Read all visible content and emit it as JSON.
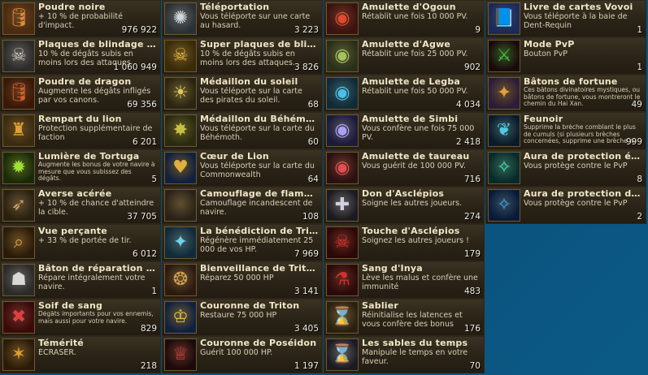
{
  "items": [
    {
      "name": "Poudre noire",
      "desc": "+ 10 % de probabilité d'impact.",
      "count": "976 922",
      "icon": "barrel-icon",
      "glyph": "🛢",
      "bg": "#4a2a10",
      "fg": "#e08a3a"
    },
    {
      "name": "Téléportation",
      "desc": "Vous téléporte sur une carte au hasard.",
      "count": "3 223",
      "icon": "compass-icon",
      "glyph": "✺",
      "bg": "#2a3036",
      "fg": "#cfd8e0"
    },
    {
      "name": "Amulette d'Ogoun",
      "desc": "Rétablit une fois 10 000 PV.",
      "count": "9",
      "icon": "red-amulet-icon",
      "glyph": "◉",
      "bg": "#3a1210",
      "fg": "#e04a30"
    },
    {
      "name": "Livre de cartes Vovoi",
      "desc": "Vous téléporte à la baie de Dent-Requin",
      "count": "1",
      "icon": "book-icon",
      "glyph": "📘",
      "bg": "#1c2a5a",
      "fg": "#5a7ad8"
    },
    {
      "name": "Plaques de blindage d'...",
      "desc": "10 % de dégâts subis en moins lors des attaques.",
      "count": "1 060 949",
      "icon": "skull-shield-icon",
      "glyph": "☠",
      "bg": "#2a2a2a",
      "fg": "#c8c8c8"
    },
    {
      "name": "Super plaques de blind...",
      "desc": "10 % de dégâts subis en moins lors des attaques.",
      "count": "3 826",
      "icon": "gold-skull-shield-icon",
      "glyph": "☠",
      "bg": "#3a2a08",
      "fg": "#e8b840"
    },
    {
      "name": "Amulette d'Agwe",
      "desc": "Rétablit une fois 25 000 PV.",
      "count": "902",
      "icon": "green-amulet-icon",
      "glyph": "◉",
      "bg": "#2a3018",
      "fg": "#a8c060"
    },
    {
      "name": "Mode PvP",
      "desc": "Bouton PvP",
      "count": "1",
      "icon": "crossed-swords-icon",
      "glyph": "⚔",
      "bg": "#1a0a0a",
      "fg": "#40c040"
    },
    {
      "name": "Poudre de dragon",
      "desc": "Augmente les dégâts infligés par vos canons.",
      "count": "69 356",
      "icon": "dragon-barrel-icon",
      "glyph": "🛢",
      "bg": "#3a1808",
      "fg": "#d0602a"
    },
    {
      "name": "Médaillon du soleil",
      "desc": "Vous téléporte sur la carte des pirates du soleil.",
      "count": "68",
      "icon": "sun-medallion-icon",
      "glyph": "☀",
      "bg": "#2a2410",
      "fg": "#e0c860"
    },
    {
      "name": "Amulette de Legba",
      "desc": "Rétablit une fois 50 000 PV.",
      "count": "4 034",
      "icon": "blue-amulet-icon",
      "glyph": "◉",
      "bg": "#102a3a",
      "fg": "#4ac0e8"
    },
    {
      "name": "Bâtons de fortune",
      "desc": "Ces bâtons divinatoires mystiques, ou bâtons de fortune, vous montreront le chemin du Hai Xan.",
      "count": "49",
      "icon": "fortune-sticks-icon",
      "glyph": "✦",
      "bg": "#2a1c3a",
      "fg": "#e0a040",
      "small": true
    },
    {
      "name": "Rempart du lion",
      "desc": "Protection supplémentaire de faction",
      "count": "6 201",
      "icon": "lion-rampart-icon",
      "glyph": "♜",
      "bg": "#3a2a10",
      "fg": "#e0a030"
    },
    {
      "name": "Médaillon du Béhémoth",
      "desc": "Vous téléporte sur la carte du Béhémoth.",
      "count": "60",
      "icon": "behemoth-medallion-icon",
      "glyph": "✸",
      "bg": "#2a2a10",
      "fg": "#c8c040"
    },
    {
      "name": "Amulette de Simbi",
      "desc": "Vous confère une fois 75 000 PV.",
      "count": "2 418",
      "icon": "violet-amulet-icon",
      "glyph": "◉",
      "bg": "#1a1a3a",
      "fg": "#a8a0f0"
    },
    {
      "name": "Feunoir",
      "desc": "Supprime la brèche comblant le plus de cumuls (si plusieurs brèches concernées, supprime une brèche au",
      "count": "999",
      "icon": "black-flame-icon",
      "glyph": "❦",
      "bg": "#0a1a2a",
      "fg": "#50c8e8",
      "small": true
    },
    {
      "name": "Lumière de Tortuga",
      "desc": "Augmente les bonus de votre navire à mesure que vous subissez des dégâts.",
      "count": "5",
      "icon": "green-lantern-icon",
      "glyph": "✹",
      "bg": "#1a2a08",
      "fg": "#a0e030",
      "small": true
    },
    {
      "name": "Cœur de Lion",
      "desc": "Vous téléporte sur la carte du Commonwealth",
      "count": "64",
      "icon": "lion-heart-icon",
      "glyph": "♥",
      "bg": "#102040",
      "fg": "#e0b040"
    },
    {
      "name": "Amulette de taureau",
      "desc": "Vous guérit de 100 000 PV.",
      "count": "716",
      "icon": "bull-amulet-icon",
      "glyph": "◉",
      "bg": "#2a1010",
      "fg": "#e05050"
    },
    {
      "name": "Aura de protection éph...",
      "desc": "Vous protège contre le PvP",
      "count": "8",
      "icon": "teal-aura-icon",
      "glyph": "✧",
      "bg": "#082a2a",
      "fg": "#40e0c8"
    },
    {
      "name": "Averse acérée",
      "desc": "+ 10 % de chance d'atteindre la cible.",
      "count": "37 705",
      "icon": "arrow-rain-icon",
      "glyph": "➶",
      "bg": "#2a2010",
      "fg": "#c8a060"
    },
    {
      "name": "Camouflage de flammes",
      "desc": "Camouflage incandescent de navire.",
      "count": "108",
      "icon": "flame-camo-icon",
      "glyph": "",
      "bg": "#2a2218",
      "fg": "#c8a060"
    },
    {
      "name": "Don d'Asclépios",
      "desc": "Soigne les autres joueurs.",
      "count": "274",
      "icon": "healing-gift-icon",
      "glyph": "✚",
      "bg": "#1a1a22",
      "fg": "#d0d0e0"
    },
    {
      "name": "Aura de protection dur...",
      "desc": "Vous protège contre le PvP",
      "count": "2",
      "icon": "blue-aura-icon",
      "glyph": "✧",
      "bg": "#0a1a3a",
      "fg": "#40a0e8"
    },
    {
      "name": "Vue perçante",
      "desc": "+ 33 % de portée de tir.",
      "count": "6 012",
      "icon": "spyglass-icon",
      "glyph": "⌕",
      "bg": "#2a1a08",
      "fg": "#e0a040"
    },
    {
      "name": "La bénédiction de Triton",
      "desc": "Régénère immédiatement 25 000 de vos HP.",
      "count": "7 969",
      "icon": "triton-blessing-icon",
      "glyph": "✦",
      "bg": "#102a3a",
      "fg": "#70d0f0"
    },
    {
      "name": "Touche d'Asclépios",
      "desc": "Soignez les autres joueurs !",
      "count": "179",
      "icon": "red-skull-icon",
      "glyph": "☠",
      "bg": "#2a0808",
      "fg": "#e03030"
    },
    {
      "name": "",
      "desc": "",
      "count": "",
      "icon": "",
      "glyph": "",
      "bg": "",
      "fg": "",
      "empty": true
    },
    {
      "name": "Bâton de réparation du...",
      "desc": "Répare intégralement votre navire.",
      "count": "1",
      "icon": "repair-staff-icon",
      "glyph": "☗",
      "bg": "#2a2a2a",
      "fg": "#d8d8d8"
    },
    {
      "name": "Bienveillance de Triton",
      "desc": "Réparez 50 000 HP",
      "count": "3 141",
      "icon": "triton-shield-icon",
      "glyph": "❂",
      "bg": "#2a1a10",
      "fg": "#d0a050"
    },
    {
      "name": "Sang d'Inya",
      "desc": "Lève les malus et confère une immunité",
      "count": "483",
      "icon": "blood-vial-icon",
      "glyph": "⚗",
      "bg": "#2a0a0a",
      "fg": "#d03030"
    },
    {
      "name": "",
      "desc": "",
      "count": "",
      "icon": "",
      "glyph": "",
      "bg": "",
      "fg": "",
      "empty": true
    },
    {
      "name": "Soif de sang",
      "desc": "Dégâts importants pour vos ennemis, mais aussi pour votre navire.",
      "count": "829",
      "icon": "bloodthirst-icon",
      "glyph": "✖",
      "bg": "#3a0a0a",
      "fg": "#e04040",
      "small": true
    },
    {
      "name": "Couronne de Triton",
      "desc": "Restaure 75 000 HP",
      "count": "3 405",
      "icon": "triton-crown-icon",
      "glyph": "♔",
      "bg": "#102040",
      "fg": "#e0c050"
    },
    {
      "name": "Sablier",
      "desc": "Réinitialise les latences et vous confère des bonus",
      "count": "176",
      "icon": "hourglass-icon",
      "glyph": "⌛",
      "bg": "#2a2010",
      "fg": "#e0b060"
    },
    {
      "name": "",
      "desc": "",
      "count": "",
      "icon": "",
      "glyph": "",
      "bg": "",
      "fg": "",
      "empty": true
    },
    {
      "name": "Témérité",
      "desc": "ÉCRASER.",
      "count": "218",
      "icon": "recklessness-icon",
      "glyph": "✶",
      "bg": "#2a1a08",
      "fg": "#e0a030"
    },
    {
      "name": "Couronne de Poséidon",
      "desc": "Guérit 100 000 HP.",
      "count": "1 197",
      "icon": "poseidon-crown-icon",
      "glyph": "♕",
      "bg": "#1a0a0a",
      "fg": "#d04040"
    },
    {
      "name": "Les sables du temps",
      "desc": "Manipule le temps en votre faveur.",
      "count": "70",
      "icon": "sands-of-time-icon",
      "glyph": "⌛",
      "bg": "#1a1a22",
      "fg": "#d0d0d8"
    },
    {
      "name": "",
      "desc": "",
      "count": "",
      "icon": "",
      "glyph": "",
      "bg": "",
      "fg": "",
      "empty": true
    }
  ]
}
